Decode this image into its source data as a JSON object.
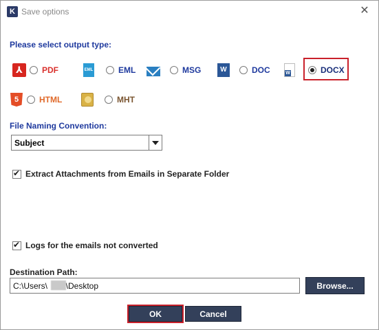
{
  "window": {
    "title": "Save options",
    "logo_letter": "K"
  },
  "output_type": {
    "label": "Please select output type:",
    "options": [
      {
        "label": "PDF",
        "icon": "pdf-icon",
        "selected": false
      },
      {
        "label": "EML",
        "icon": "eml-icon",
        "selected": false
      },
      {
        "label": "MSG",
        "icon": "msg-envelope-icon",
        "selected": false
      },
      {
        "label": "DOC",
        "icon": "word-doc-icon",
        "selected": false
      },
      {
        "label": "DOCX",
        "icon": "word-docx-icon",
        "selected": true
      },
      {
        "label": "HTML",
        "icon": "html5-icon",
        "selected": false
      },
      {
        "label": "MHT",
        "icon": "mht-icon",
        "selected": false
      }
    ],
    "icon_text": {
      "eml": "EML",
      "doc": "W",
      "html": "5"
    }
  },
  "naming": {
    "label": "File Naming Convention:",
    "selected": "Subject"
  },
  "checkboxes": {
    "extract_attachments": {
      "label": "Extract Attachments from Emails in Separate Folder",
      "checked": true
    },
    "logs": {
      "label": "Logs for the emails not converted",
      "checked": true
    }
  },
  "destination": {
    "label": "Destination Path:",
    "value": "C:\\Users\\        \\Desktop",
    "browse_label": "Browse..."
  },
  "buttons": {
    "ok": "OK",
    "cancel": "Cancel"
  },
  "colors": {
    "accent_blue": "#1f3a9e",
    "button_bg": "#33405a",
    "highlight_red": "#c9202a"
  }
}
